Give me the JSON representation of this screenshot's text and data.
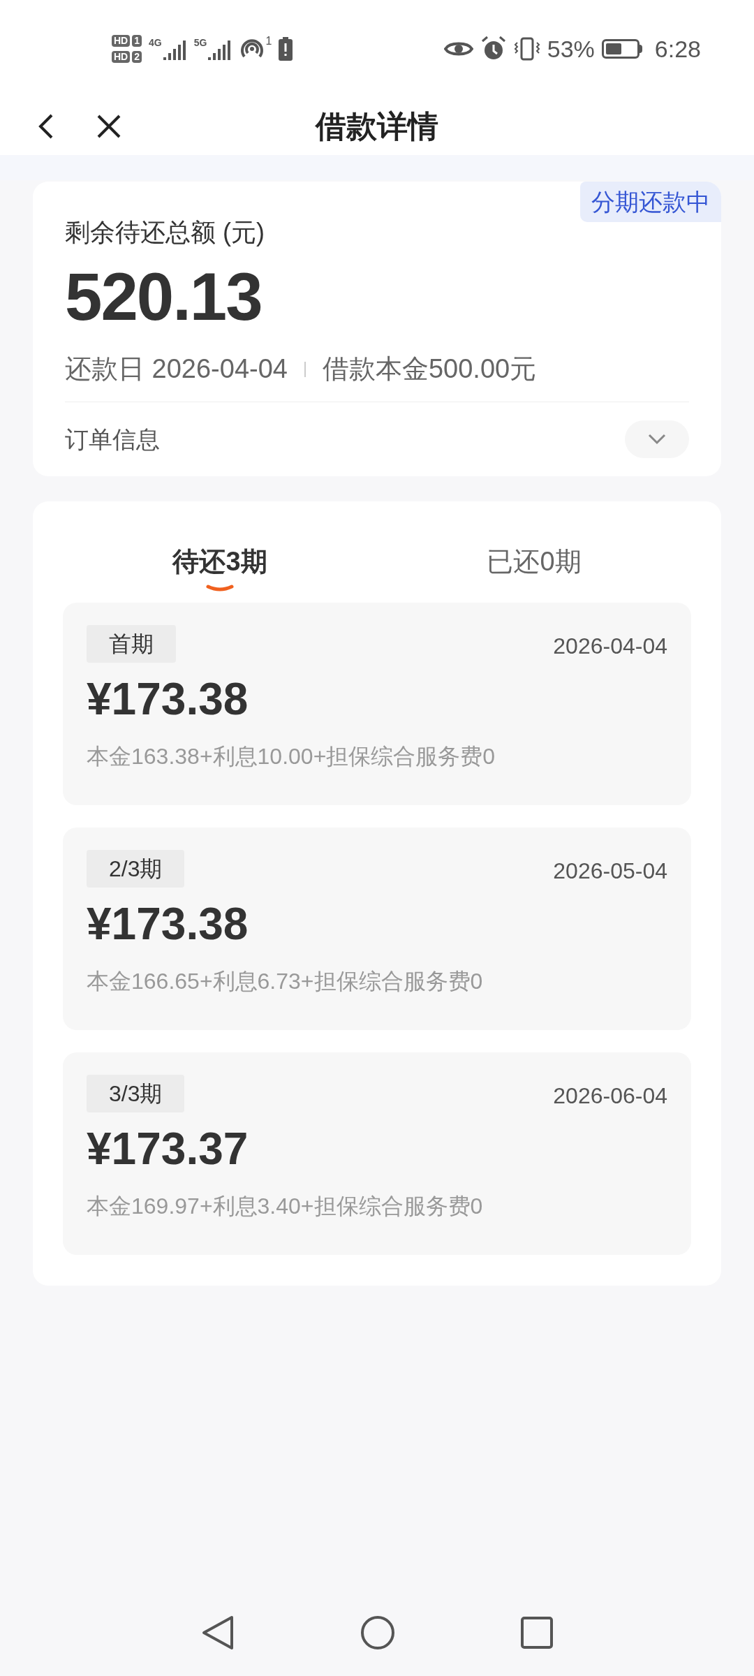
{
  "status_bar": {
    "sims": [
      {
        "hd": "HD",
        "slot": "1"
      },
      {
        "hd": "HD",
        "slot": "2"
      }
    ],
    "networks": [
      {
        "label": "4G"
      },
      {
        "label": "5G"
      }
    ],
    "hotspot_count": "1",
    "battery": {
      "text": "53%"
    },
    "time": "6:28"
  },
  "nav": {
    "title": "借款详情"
  },
  "summary": {
    "badge": "分期还款中",
    "label": "剩余待还总额 (元)",
    "amount": "520.13",
    "due_date": "还款日 2026-04-04",
    "principal": "借款本金500.00元",
    "order_info": "订单信息",
    "expanded": false
  },
  "tabs": [
    {
      "label": "待还3期",
      "selected": true
    },
    {
      "label": "已还0期",
      "selected": false
    }
  ],
  "installments": [
    {
      "term": "首期",
      "date": "2026-04-04",
      "amount": "¥173.38",
      "detail": "本金163.38+利息10.00+担保综合服务费0"
    },
    {
      "term": "2/3期",
      "date": "2026-05-04",
      "amount": "¥173.38",
      "detail": "本金166.65+利息6.73+担保综合服务费0"
    },
    {
      "term": "3/3期",
      "date": "2026-06-04",
      "amount": "¥173.37",
      "detail": "本金169.97+利息3.40+担保综合服务费0"
    }
  ]
}
